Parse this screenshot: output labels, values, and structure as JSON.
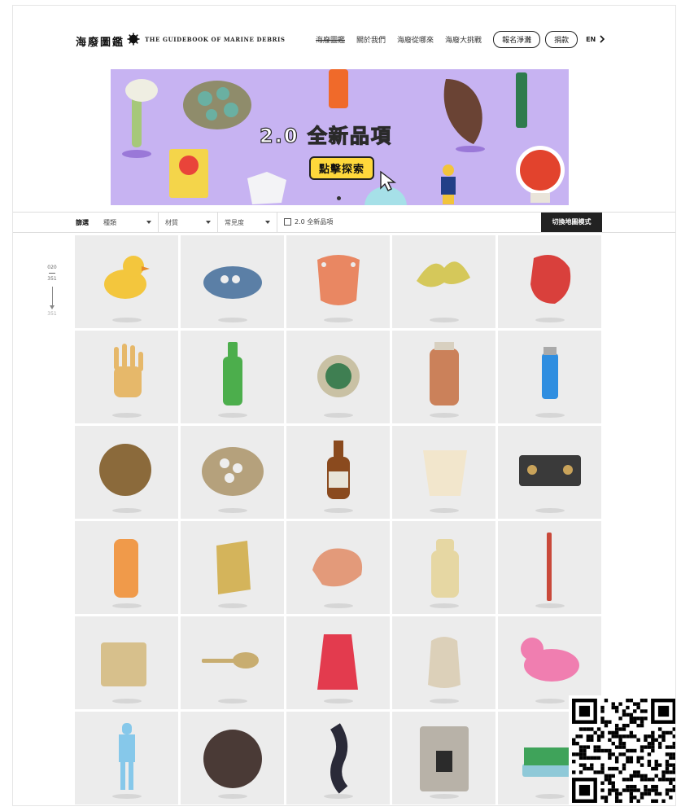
{
  "header": {
    "logo_title": "海廢圖鑑",
    "logo_subtitle": "THE GUIDEBOOK OF MARINE DEBRIS",
    "nav": [
      {
        "label": "海廢圖鑑",
        "current": true
      },
      {
        "label": "關於我們",
        "current": false
      },
      {
        "label": "海廢從哪來",
        "current": false
      },
      {
        "label": "海廢大挑戰",
        "current": false
      }
    ],
    "signup_label": "報名淨灘",
    "donate_label": "捐款",
    "lang_label": "EN"
  },
  "banner": {
    "title": "2.0 全新品項",
    "cta_label": "點擊探索",
    "background": "#c7b3f2",
    "cta_color": "#ffd83b"
  },
  "filters": {
    "label": "篩選",
    "selects": [
      "種類",
      "材質",
      "常見度"
    ],
    "checkbox_label": "2.0 全新品項",
    "map_toggle_label": "切換地圖模式"
  },
  "counter": {
    "current": "020",
    "total": "351",
    "total_bottom": "351"
  },
  "items": [
    {
      "icon": "rubber-duck-icon",
      "color": "#f3c63d"
    },
    {
      "icon": "shoe-icon",
      "color": "#5b7fa6"
    },
    {
      "icon": "buoy-fragment-icon",
      "color": "#e98762"
    },
    {
      "icon": "net-fragment-icon",
      "color": "#d5c85a"
    },
    {
      "icon": "red-plastic-icon",
      "color": "#d9403c"
    },
    {
      "icon": "glove-icon",
      "color": "#e6b86a"
    },
    {
      "icon": "green-bottle-icon",
      "color": "#4cae4c"
    },
    {
      "icon": "tin-can-icon",
      "color": "#c9c1a4"
    },
    {
      "icon": "jar-icon",
      "color": "#c8764a"
    },
    {
      "icon": "lighter-icon",
      "color": "#2f8ee0"
    },
    {
      "icon": "coconut-icon",
      "color": "#8b6a3b"
    },
    {
      "icon": "barnacle-cluster-icon",
      "color": "#b5a17c"
    },
    {
      "icon": "sauce-bottle-icon",
      "color": "#8a4a1e"
    },
    {
      "icon": "cup-icon",
      "color": "#f2e6cc"
    },
    {
      "icon": "tire-piece-icon",
      "color": "#3a3a3a"
    },
    {
      "icon": "toy-figure-icon",
      "color": "#f09a4a"
    },
    {
      "icon": "wrapper-icon",
      "color": "#d4b45b"
    },
    {
      "icon": "foam-icon",
      "color": "#e39a7a"
    },
    {
      "icon": "drink-bottle-icon",
      "color": "#e6d7a3"
    },
    {
      "icon": "stick-icon",
      "color": "#c9493a"
    },
    {
      "icon": "box-icon",
      "color": "#d7c08c"
    },
    {
      "icon": "spoon-icon",
      "color": "#c8ad70"
    },
    {
      "icon": "fruit-net-icon",
      "color": "#e33b4e"
    },
    {
      "icon": "plastic-bag-icon",
      "color": "#d9cbb0"
    },
    {
      "icon": "pink-toy-icon",
      "color": "#f07eb0"
    },
    {
      "icon": "figurine-icon",
      "color": "#86c8ea"
    },
    {
      "icon": "float-ball-icon",
      "color": "#4a3a36"
    },
    {
      "icon": "rope-icon",
      "color": "#2a2a38"
    },
    {
      "icon": "printed-bag-icon",
      "color": "#b8b2a8"
    },
    {
      "icon": "brush-icon",
      "color": "#3fa35a"
    }
  ]
}
